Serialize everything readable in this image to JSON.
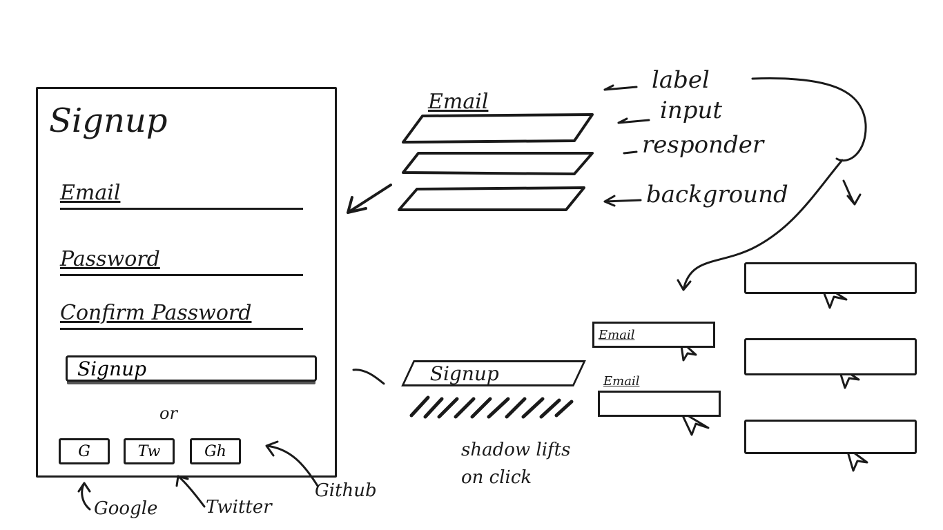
{
  "signup_panel": {
    "title": "Signup",
    "fields": [
      {
        "label": "Email"
      },
      {
        "label": "Password"
      },
      {
        "label": "Confirm Password"
      }
    ],
    "signup_button": "Signup",
    "divider": "or",
    "social_buttons": [
      {
        "glyph": "G",
        "icon": "google-icon"
      },
      {
        "glyph": "Tw",
        "icon": "twitter-icon"
      },
      {
        "glyph": "Gh",
        "icon": "github-icon"
      }
    ]
  },
  "layers_demo": {
    "field_label": "Email",
    "annotations": [
      "label",
      "input",
      "responder",
      "background"
    ]
  },
  "button_demo": {
    "label": "Signup",
    "note": "shadow lifts on click"
  },
  "states_demo": {
    "email_labels": [
      "Email",
      "Email"
    ]
  },
  "captions": {
    "google": "Google",
    "twitter": "Twitter",
    "github": "Github"
  }
}
